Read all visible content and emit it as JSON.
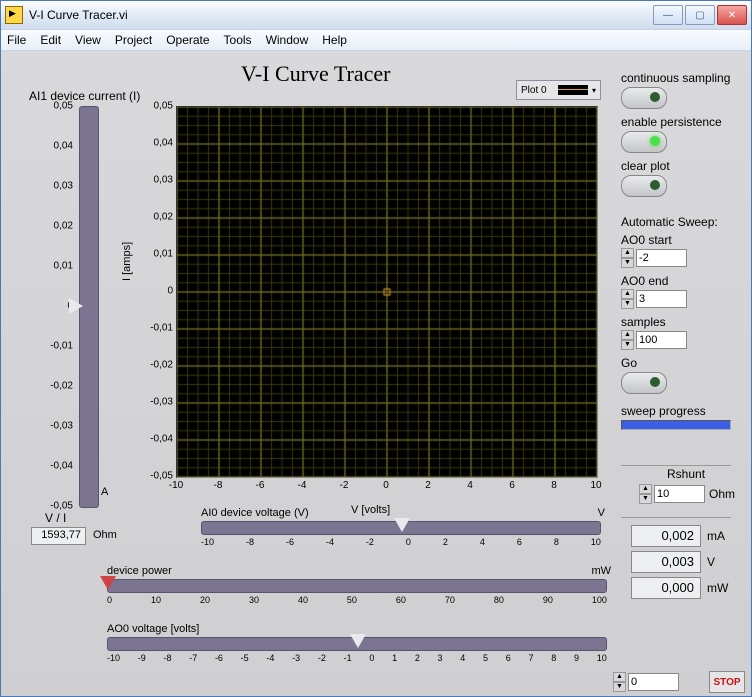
{
  "window": {
    "title": "V-I Curve Tracer.vi"
  },
  "menu": [
    "File",
    "Edit",
    "View",
    "Project",
    "Operate",
    "Tools",
    "Window",
    "Help"
  ],
  "page": {
    "title": "V-I Curve Tracer"
  },
  "vertGauge": {
    "label": "AI1 device current (I)",
    "unit": "A",
    "ticks": [
      "0,05",
      "0,04",
      "0,03",
      "0,02",
      "0,01",
      "0",
      "-0,01",
      "-0,02",
      "-0,03",
      "-0,04",
      "-0,05"
    ]
  },
  "plot": {
    "legend": "Plot 0",
    "ylabel": "I [amps]",
    "xlabel": "V [volts]",
    "yticks": [
      "0,05",
      "0,04",
      "0,03",
      "0,02",
      "0,01",
      "0",
      "-0,01",
      "-0,02",
      "-0,03",
      "-0,04",
      "-0,05"
    ],
    "xticks": [
      "-10",
      "-8",
      "-6",
      "-4",
      "-2",
      "0",
      "2",
      "4",
      "6",
      "8",
      "10"
    ]
  },
  "rc": {
    "contSamp": "continuous sampling",
    "enPers": "enable persistence",
    "clearPlot": "clear plot",
    "autoSweep": "Automatic Sweep:",
    "ao0start_l": "AO0 start",
    "ao0start": "-2",
    "ao0end_l": "AO0 end",
    "ao0end": "3",
    "samples_l": "samples",
    "samples": "100",
    "go": "Go",
    "sweepProg": "sweep progress",
    "rshunt_l": "Rshunt",
    "rshunt": "10",
    "rshunt_u": "Ohm"
  },
  "vi": {
    "label": "V / I",
    "value": "1593,77",
    "unit": "Ohm"
  },
  "slider1": {
    "cap": "AI0 device voltage (V)",
    "unit": "V",
    "scale": [
      "-10",
      "-8",
      "-6",
      "-4",
      "-2",
      "0",
      "2",
      "4",
      "6",
      "8",
      "10"
    ]
  },
  "slider2": {
    "cap": "device power",
    "unit": "mW",
    "scale": [
      "0",
      "10",
      "20",
      "30",
      "40",
      "50",
      "60",
      "70",
      "80",
      "90",
      "100"
    ]
  },
  "slider3": {
    "cap": "AO0 voltage [volts]",
    "unit": "",
    "scale": [
      "-10",
      "-9",
      "-8",
      "-7",
      "-6",
      "-5",
      "-4",
      "-3",
      "-2",
      "-1",
      "0",
      "1",
      "2",
      "3",
      "4",
      "5",
      "6",
      "7",
      "8",
      "9",
      "10"
    ]
  },
  "readout": {
    "mA": "0,002",
    "V": "0,003",
    "mW": "0,000",
    "mA_u": "mA",
    "V_u": "V",
    "mW_u": "mW"
  },
  "ao0box": "0",
  "stop": "STOP",
  "chart_data": {
    "type": "scatter",
    "title": "V-I Curve Tracer",
    "xlabel": "V [volts]",
    "ylabel": "I [amps]",
    "xlim": [
      -10,
      10
    ],
    "ylim": [
      -0.05,
      0.05
    ],
    "series": [
      {
        "name": "Plot 0",
        "x": [
          0
        ],
        "y": [
          0
        ]
      }
    ]
  }
}
